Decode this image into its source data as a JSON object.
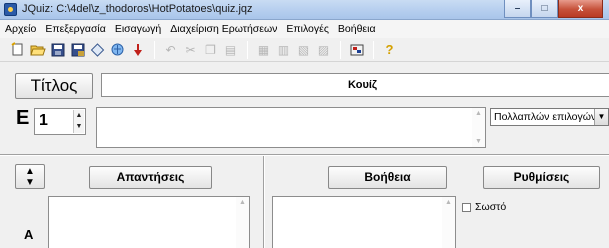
{
  "window": {
    "title": "JQuiz: C:\\4del\\z_thodoros\\HotPotatoes\\quiz.jqz",
    "minimize": "–",
    "maximize": "□",
    "close": "x"
  },
  "menu": [
    "Αρχείο",
    "Επεξεργασία",
    "Εισαγωγή",
    "Διαχείριση Ερωτήσεων",
    "Επιλογές",
    "Βοήθεια"
  ],
  "toolbar": {
    "icons": [
      "new-file-icon",
      "open-folder-icon",
      "save-icon",
      "save-as-icon",
      "web-page-icon",
      "export-icon",
      "sort-icon",
      "undo-icon",
      "cut-icon",
      "copy-icon",
      "paste-icon",
      "image-icon",
      "table-icon",
      "gap-icon",
      "links-icon",
      "config-icon",
      "help-icon"
    ],
    "help_glyph": "?"
  },
  "title_section": {
    "label": "Τίτλος",
    "value": "Κουίζ"
  },
  "question": {
    "prefix": "E",
    "number": "1",
    "text": "",
    "type": "Πολλαπλών επιλογών"
  },
  "answers": {
    "sort_up": "▲",
    "sort_down": "▼",
    "header": "Απαντήσεις",
    "help_header": "Βοήθεια",
    "settings_header": "Ρυθμίσεις",
    "row_label": "A",
    "correct_label": "Σωστό"
  }
}
